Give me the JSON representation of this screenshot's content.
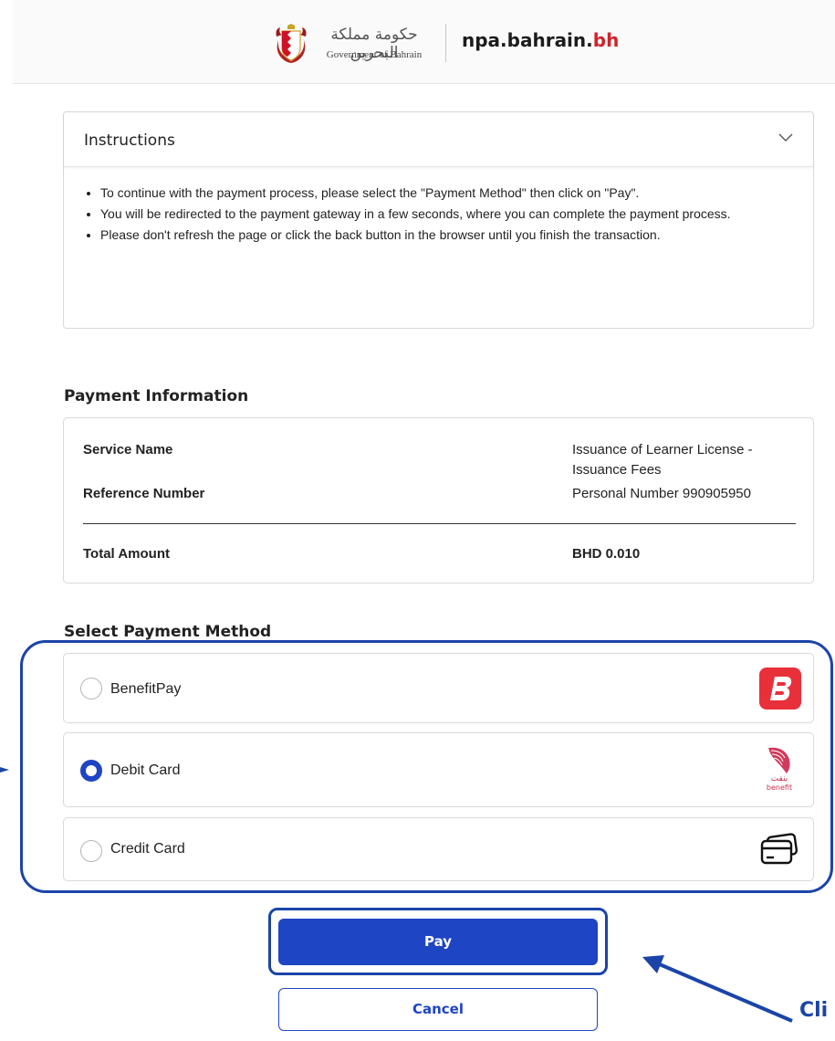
{
  "header": {
    "gov_arabic": "حكومة مملكة البحرين",
    "gov_text": "Government of Bahrain",
    "site_name": "npa.bahrain.",
    "site_tld": "bh"
  },
  "instructions": {
    "title": "Instructions",
    "items": [
      "To continue with the payment process, please select the \"Payment Method\" then click on \"Pay\".",
      "You will be redirected to the payment gateway in a few seconds, where you can complete the payment process.",
      "Please don't refresh the page or click the back button in the browser until you finish the transaction."
    ]
  },
  "payment_info": {
    "title": "Payment Information",
    "service_name_label": "Service Name",
    "service_name_value": "Issuance of Learner License - Issuance Fees",
    "reference_label": "Reference Number",
    "reference_value": "Personal Number 990905950",
    "total_label": "Total Amount",
    "total_value": "BHD 0.010"
  },
  "payment_methods": {
    "title": "Select Payment Method",
    "options": [
      {
        "label": "BenefitPay",
        "selected": false,
        "icon": "benefitpay-logo"
      },
      {
        "label": "Debit Card",
        "selected": true,
        "icon": "benefit-logo"
      },
      {
        "label": "Credit Card",
        "selected": false,
        "icon": "credit-card-icon"
      }
    ],
    "benefit_logo_arabic": "بنفت",
    "benefit_logo_text": "benefit"
  },
  "buttons": {
    "pay": "Pay",
    "cancel": "Cancel"
  },
  "annotation": {
    "text": "Cli"
  },
  "colors": {
    "primary": "#1e45c3",
    "annotation": "#1a44a8",
    "benefitpay": "#e8303a",
    "brand_red": "#d2232a"
  }
}
